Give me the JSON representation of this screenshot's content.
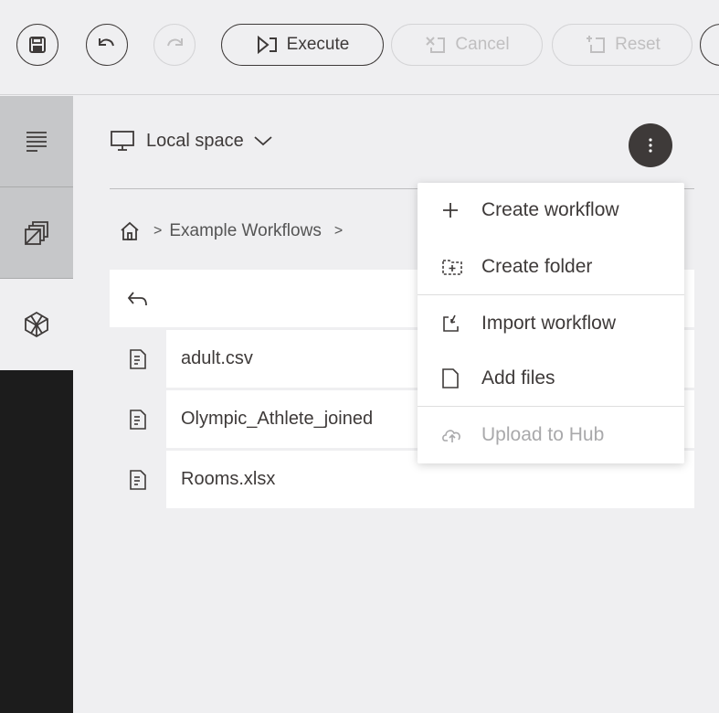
{
  "toolbar": {
    "save": {
      "icon": "save-icon"
    },
    "undo": {
      "icon": "undo-icon"
    },
    "redo": {
      "icon": "redo-icon"
    },
    "execute": {
      "label": "Execute",
      "icon": "execute-icon"
    },
    "cancel": {
      "label": "Cancel",
      "icon": "cancel-icon"
    },
    "reset": {
      "label": "Reset",
      "icon": "reset-icon"
    }
  },
  "rail": {
    "items": [
      {
        "name": "description",
        "icon": "description-icon"
      },
      {
        "name": "nodes",
        "icon": "node-repository-icon"
      },
      {
        "name": "space-explorer",
        "icon": "cube-icon"
      }
    ]
  },
  "space": {
    "label": "Local space",
    "icon": "computer-icon"
  },
  "breadcrumb": {
    "home_icon": "home-icon",
    "separator": ">",
    "items": [
      "Example Workflows",
      ">"
    ]
  },
  "files": [
    {
      "name": "adult.csv",
      "icon": "file-icon"
    },
    {
      "name": "Olympic_Athlete_joined",
      "icon": "file-icon"
    },
    {
      "name": "Rooms.xlsx",
      "icon": "file-icon"
    }
  ],
  "menu": {
    "items": [
      {
        "label": "Create workflow",
        "icon": "plus-icon",
        "disabled": false
      },
      {
        "label": "Create folder",
        "icon": "folder-plus-icon",
        "disabled": false
      },
      {
        "label": "Import workflow",
        "icon": "import-icon",
        "disabled": false
      },
      {
        "label": "Add files",
        "icon": "file-add-icon",
        "disabled": false
      },
      {
        "label": "Upload to Hub",
        "icon": "cloud-upload-icon",
        "disabled": true
      }
    ]
  },
  "colors": {
    "background": "#efeff1",
    "dark": "#3e3a39",
    "rail_dark": "#1c1c1c",
    "rail_inactive": "#c6c7c9",
    "disabled": "#c0bfc0"
  }
}
